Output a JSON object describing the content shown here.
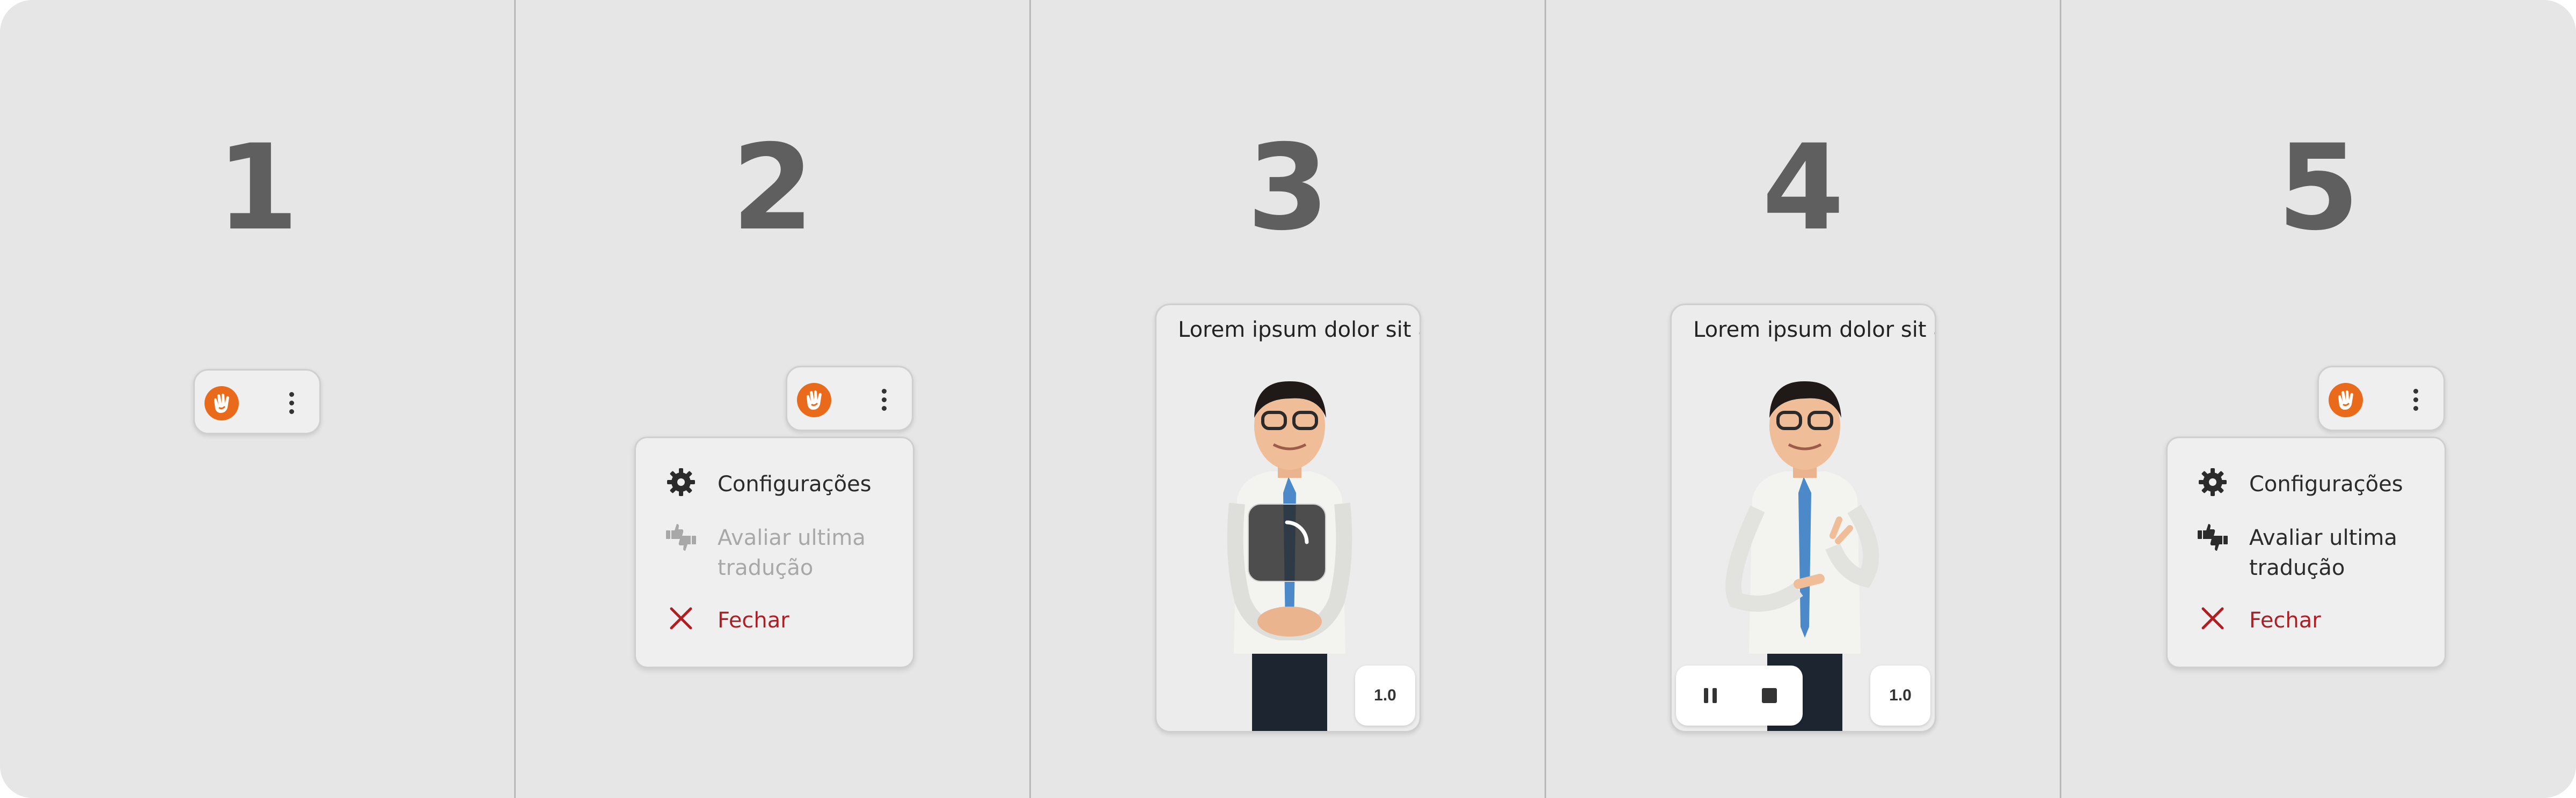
{
  "steps": [
    {
      "number": "1"
    },
    {
      "number": "2"
    },
    {
      "number": "3"
    },
    {
      "number": "4"
    },
    {
      "number": "5"
    }
  ],
  "menu": {
    "settings_label": "Configurações",
    "rate_label_line1": "Avaliar ultima",
    "rate_label_line2": "tradução",
    "close_label": "Fechar"
  },
  "player": {
    "caption": "Lorem ipsum dolor sit amet",
    "speed": "1.0"
  },
  "colors": {
    "background": "#e6e6e6",
    "brand_orange": "#ea6a1c",
    "number_gray": "#5f5f5f",
    "close_red": "#b01e24",
    "disabled_gray": "#a8a8a8"
  },
  "icons": [
    "hand-logo-icon",
    "kebab-menu-icon",
    "gear-icon",
    "thumbs-rate-icon",
    "close-icon",
    "loading-spinner-icon",
    "pause-icon",
    "stop-icon"
  ]
}
